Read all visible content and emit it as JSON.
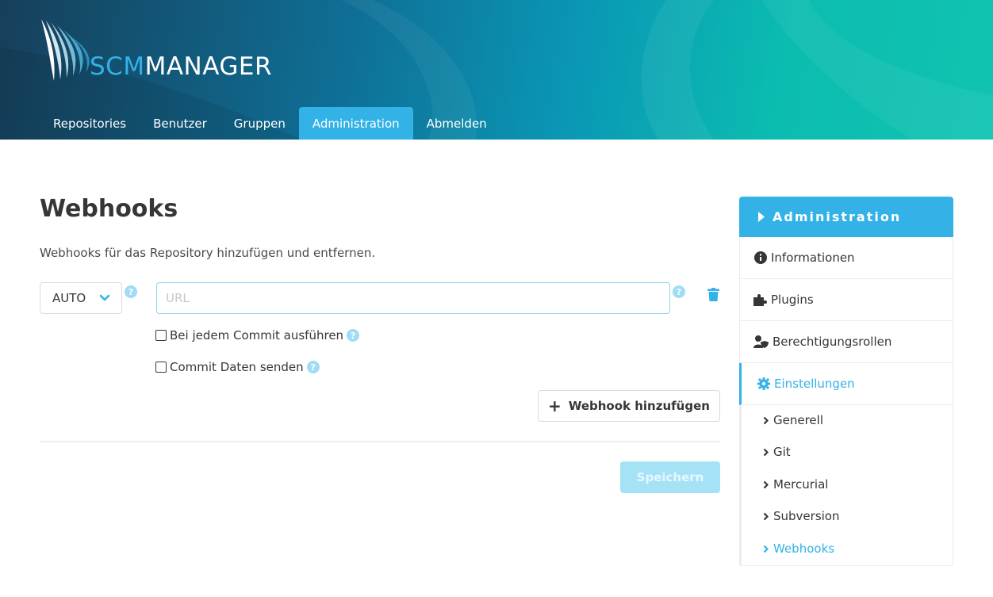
{
  "header": {
    "logo": {
      "part1": "SCM",
      "part2": "MANAGER"
    },
    "nav": [
      {
        "label": "Repositories",
        "active": false
      },
      {
        "label": "Benutzer",
        "active": false
      },
      {
        "label": "Gruppen",
        "active": false
      },
      {
        "label": "Administration",
        "active": true
      },
      {
        "label": "Abmelden",
        "active": false
      }
    ]
  },
  "main": {
    "title": "Webhooks",
    "description": "Webhooks für das Repository hinzufügen und entfernen.",
    "method_select": {
      "value": "AUTO"
    },
    "url_input": {
      "value": "",
      "placeholder": "URL"
    },
    "checkboxes": [
      {
        "label": "Bei jedem Commit ausführen",
        "checked": false
      },
      {
        "label": "Commit Daten senden",
        "checked": false
      }
    ],
    "add_button": "Webhook hinzufügen",
    "save_button": "Speichern"
  },
  "sidebar": {
    "header": "Administration",
    "items": [
      {
        "label": "Informationen",
        "icon": "info-circle-icon"
      },
      {
        "label": "Plugins",
        "icon": "puzzle-icon"
      },
      {
        "label": "Berechtigungsrollen",
        "icon": "user-shield-icon"
      },
      {
        "label": "Einstellungen",
        "icon": "gear-icon",
        "active": true
      }
    ],
    "subitems": [
      {
        "label": "Generell"
      },
      {
        "label": "Git"
      },
      {
        "label": "Mercurial"
      },
      {
        "label": "Subversion"
      },
      {
        "label": "Webhooks",
        "active": true
      }
    ]
  },
  "colors": {
    "accent": "#33b2e8",
    "header_dark": "#163f5a",
    "header_teal": "#11c3b0",
    "text": "#363636"
  }
}
